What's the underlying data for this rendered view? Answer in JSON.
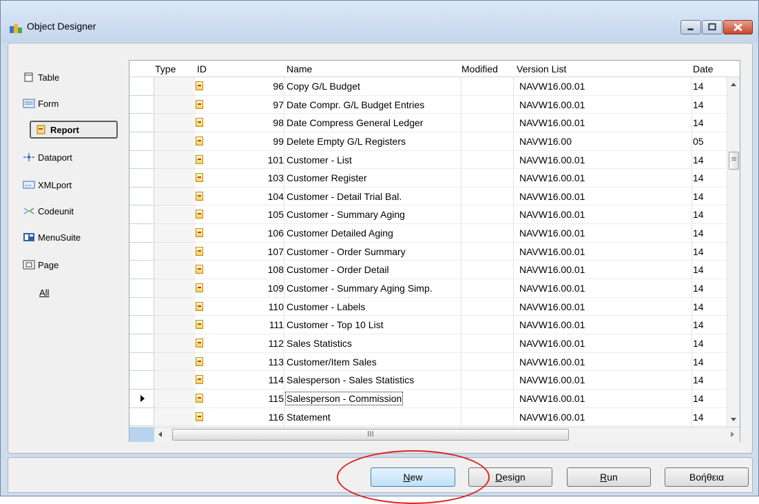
{
  "window": {
    "title": "Object Designer",
    "controls": [
      "minimize",
      "maximize",
      "close"
    ]
  },
  "sidebar": {
    "items": [
      {
        "label": "Table",
        "icon": "table-icon",
        "active": false
      },
      {
        "label": "Form",
        "icon": "form-icon",
        "active": false
      },
      {
        "label": "Report",
        "icon": "report-icon",
        "active": true
      },
      {
        "label": "Dataport",
        "icon": "dataport-icon",
        "active": false
      },
      {
        "label": "XMLport",
        "icon": "xmlport-icon",
        "active": false
      },
      {
        "label": "Codeunit",
        "icon": "codeunit-icon",
        "active": false
      },
      {
        "label": "MenuSuite",
        "icon": "menusuite-icon",
        "active": false
      },
      {
        "label": "Page",
        "icon": "page-icon",
        "active": false
      },
      {
        "label": "All",
        "icon": "",
        "active": false
      }
    ]
  },
  "table": {
    "columns": [
      "Type",
      "ID",
      "Name",
      "Modified",
      "Version List",
      "Date"
    ],
    "rows": [
      {
        "id": "96",
        "name": "Copy G/L Budget",
        "version": "NAVW16.00.01",
        "date": "14",
        "current": false
      },
      {
        "id": "97",
        "name": "Date Compr. G/L Budget Entries",
        "version": "NAVW16.00.01",
        "date": "14",
        "current": false
      },
      {
        "id": "98",
        "name": "Date Compress General Ledger",
        "version": "NAVW16.00.01",
        "date": "14",
        "current": false
      },
      {
        "id": "99",
        "name": "Delete Empty G/L Registers",
        "version": "NAVW16.00",
        "date": "05",
        "current": false
      },
      {
        "id": "101",
        "name": "Customer - List",
        "version": "NAVW16.00.01",
        "date": "14",
        "current": false
      },
      {
        "id": "103",
        "name": "Customer Register",
        "version": "NAVW16.00.01",
        "date": "14",
        "current": false
      },
      {
        "id": "104",
        "name": "Customer - Detail Trial Bal.",
        "version": "NAVW16.00.01",
        "date": "14",
        "current": false
      },
      {
        "id": "105",
        "name": "Customer - Summary Aging",
        "version": "NAVW16.00.01",
        "date": "14",
        "current": false
      },
      {
        "id": "106",
        "name": "Customer Detailed Aging",
        "version": "NAVW16.00.01",
        "date": "14",
        "current": false
      },
      {
        "id": "107",
        "name": "Customer - Order Summary",
        "version": "NAVW16.00.01",
        "date": "14",
        "current": false
      },
      {
        "id": "108",
        "name": "Customer - Order Detail",
        "version": "NAVW16.00.01",
        "date": "14",
        "current": false
      },
      {
        "id": "109",
        "name": "Customer - Summary Aging Simp.",
        "version": "NAVW16.00.01",
        "date": "14",
        "current": false
      },
      {
        "id": "110",
        "name": "Customer - Labels",
        "version": "NAVW16.00.01",
        "date": "14",
        "current": false
      },
      {
        "id": "111",
        "name": "Customer - Top 10 List",
        "version": "NAVW16.00.01",
        "date": "14",
        "current": false
      },
      {
        "id": "112",
        "name": "Sales Statistics",
        "version": "NAVW16.00.01",
        "date": "14",
        "current": false
      },
      {
        "id": "113",
        "name": "Customer/Item Sales",
        "version": "NAVW16.00.01",
        "date": "14",
        "current": false
      },
      {
        "id": "114",
        "name": "Salesperson - Sales Statistics",
        "version": "NAVW16.00.01",
        "date": "14",
        "current": false
      },
      {
        "id": "115",
        "name": "Salesperson - Commission",
        "version": "NAVW16.00.01",
        "date": "14",
        "current": true
      },
      {
        "id": "116",
        "name": "Statement",
        "version": "NAVW16.00.01",
        "date": "14",
        "current": false
      }
    ]
  },
  "scroll": {
    "hscroll_grip": "III"
  },
  "buttons": [
    {
      "label": "New",
      "key": "N",
      "rest": "ew",
      "primary": true
    },
    {
      "label": "Design",
      "key": "D",
      "rest": "esign",
      "primary": false
    },
    {
      "label": "Run",
      "key": "R",
      "rest": "un",
      "primary": false
    },
    {
      "label": "Βοήθεια",
      "key": "",
      "rest": "Βοήθεια",
      "primary": false
    }
  ],
  "colors": {
    "callout": "#e02020",
    "selected_corner": "#b8d3ef",
    "report_icon": "#f5d35a"
  }
}
